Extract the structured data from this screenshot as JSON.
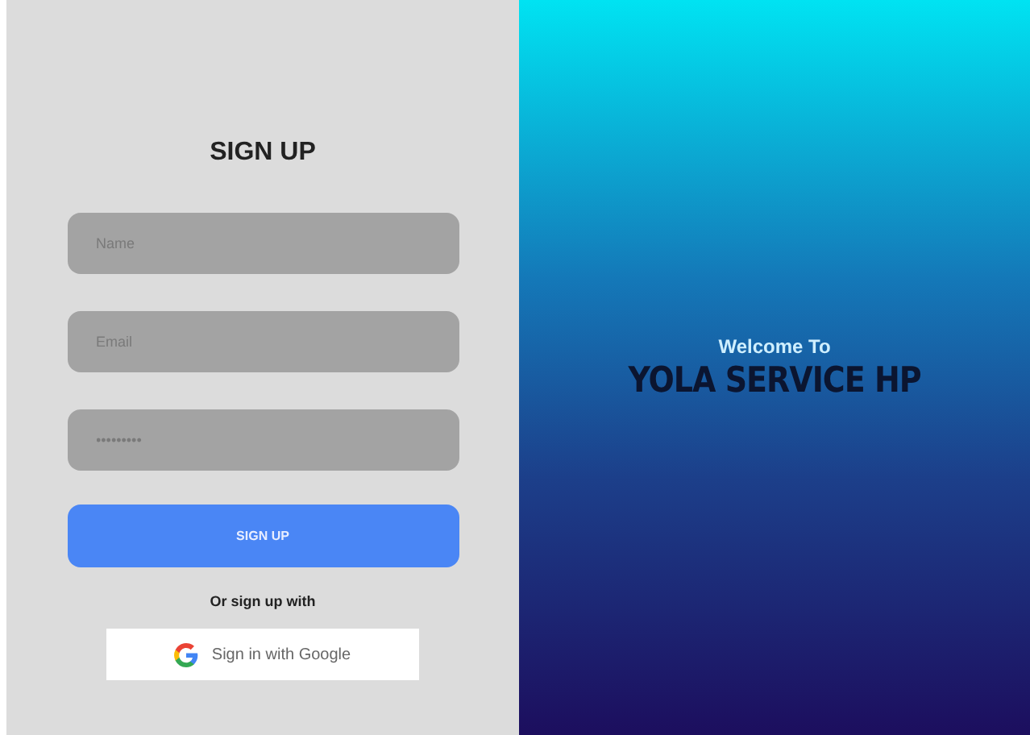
{
  "signup": {
    "title": "SIGN UP",
    "fields": [
      {
        "placeholder": "Name"
      },
      {
        "placeholder": "Email"
      },
      {
        "placeholder": "•••••••••"
      }
    ],
    "submit": "SIGN UP",
    "alt_text": "Or sign up with",
    "google_button": "Sign in with Google"
  },
  "welcome": {
    "subtitle": "Welcome To",
    "title": "YOLA SERVICE HP"
  }
}
